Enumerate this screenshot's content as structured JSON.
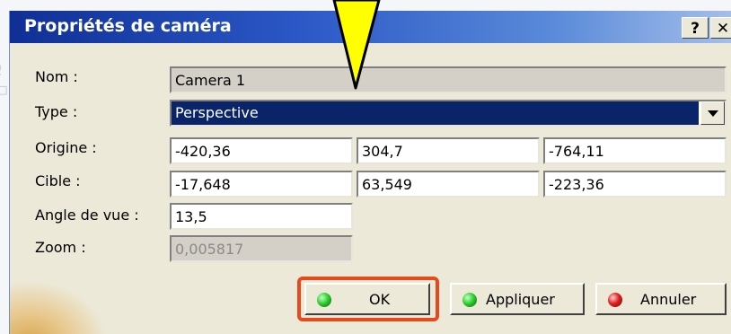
{
  "dialog": {
    "title": "Propriétés de caméra",
    "help_label": "?",
    "close_label": "✕"
  },
  "form": {
    "name": {
      "label": "Nom :",
      "value": "Camera  1"
    },
    "type": {
      "label": "Type :",
      "value": "Perspective"
    },
    "origin": {
      "label": "Origine :",
      "x": "-420,36",
      "y": "304,7",
      "z": "-764,11"
    },
    "target": {
      "label": "Cible :",
      "x": "-17,648",
      "y": "63,549",
      "z": "-223,36"
    },
    "view_angle": {
      "label": "Angle de vue :",
      "value": "13,5"
    },
    "zoom": {
      "label": "Zoom :",
      "value": "0,005817"
    }
  },
  "buttons": {
    "ok": "OK",
    "apply": "Appliquer",
    "cancel": "Annuler"
  },
  "colors": {
    "titlebar": "#0f2f95",
    "selection": "#0a246a",
    "highlight": "#e8481a",
    "callout": "#ffff00"
  }
}
